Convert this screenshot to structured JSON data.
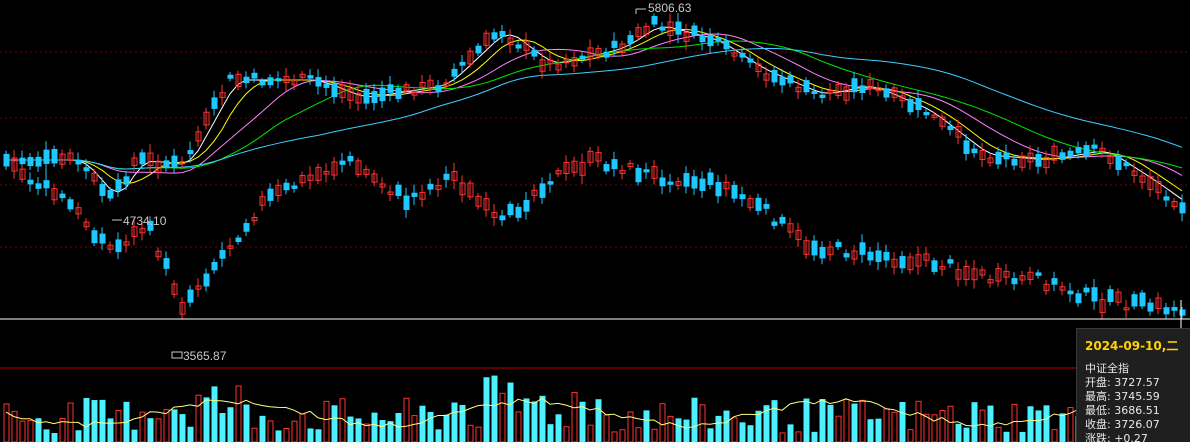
{
  "chart_data": {
    "type": "candlestick",
    "index_name": "中证全指",
    "annotations": {
      "high_label": "5806.63",
      "low_label": "3565.87",
      "mid_label": "4734.10"
    },
    "tooltip": {
      "date": "2024-09-10,二",
      "name": "中证全指",
      "rows": [
        {
          "label": "开盘",
          "value": "3727.57"
        },
        {
          "label": "最高",
          "value": "3745.59"
        },
        {
          "label": "最低",
          "value": "3686.51"
        },
        {
          "label": "收盘",
          "value": "3726.07"
        },
        {
          "label": "涨跌",
          "value": "+0.27"
        }
      ]
    },
    "colors": {
      "up": "#ff3232",
      "down": "#1ec8ff",
      "ma5": "#ffffff",
      "ma10": "#ffff00",
      "ma20": "#ff80ff",
      "ma30": "#00e600",
      "ma60": "#3ccfff"
    }
  }
}
